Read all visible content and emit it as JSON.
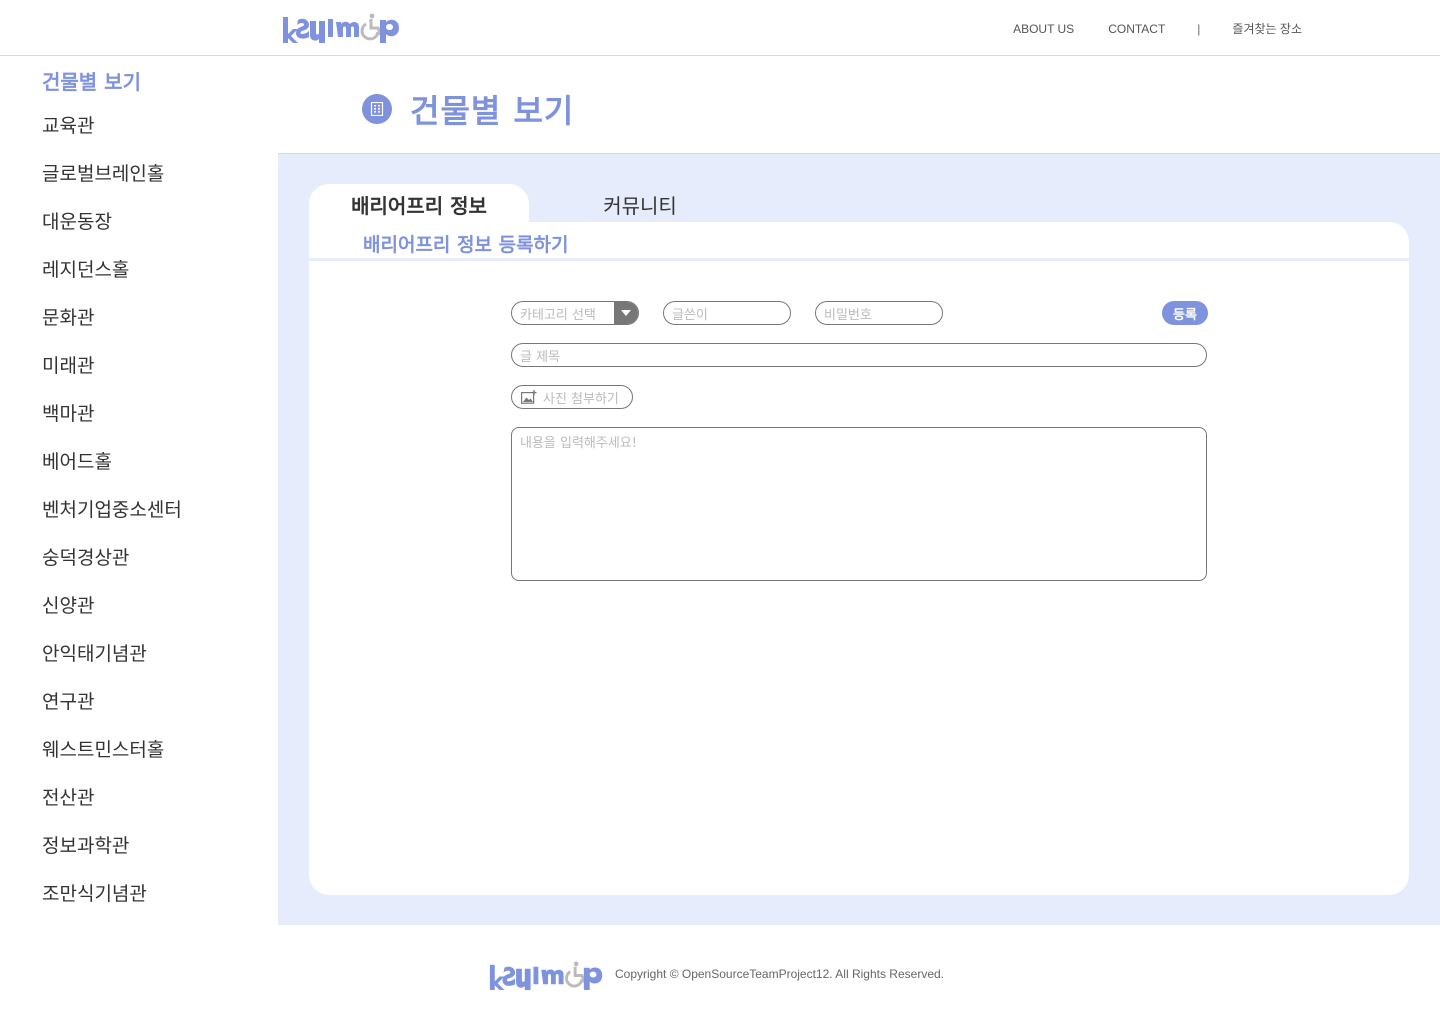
{
  "header": {
    "nav": {
      "about": "ABOUT US",
      "contact": "CONTACT",
      "separator": "|",
      "favorites": "즐겨찾는 장소"
    }
  },
  "sidebar": {
    "title": "건물별 보기",
    "items": [
      {
        "label": "교육관"
      },
      {
        "label": "글로벌브레인홀"
      },
      {
        "label": "대운동장"
      },
      {
        "label": "레지던스홀"
      },
      {
        "label": "문화관"
      },
      {
        "label": "미래관"
      },
      {
        "label": "백마관"
      },
      {
        "label": "베어드홀"
      },
      {
        "label": "벤처기업중소센터"
      },
      {
        "label": "숭덕경상관"
      },
      {
        "label": "신양관"
      },
      {
        "label": "안익태기념관"
      },
      {
        "label": "연구관"
      },
      {
        "label": "웨스트민스터홀"
      },
      {
        "label": "전산관"
      },
      {
        "label": "정보과학관"
      },
      {
        "label": "조만식기념관"
      }
    ]
  },
  "main": {
    "page_title": "건물별 보기",
    "page_icon": "building-icon",
    "tabs": [
      {
        "label": "배리어프리 정보",
        "active": true
      },
      {
        "label": "커뮤니티",
        "active": false
      }
    ],
    "form": {
      "heading": "배리어프리 정보 등록하기",
      "category_placeholder": "카테고리 선택",
      "writer_placeholder": "글쓴이",
      "password_placeholder": "비밀번호",
      "register_label": "등록",
      "title_placeholder": "글 제목",
      "attach_label": "사진 첨부하기",
      "content_placeholder": "내용을 입력해주세요!"
    }
  },
  "footer": {
    "copyright": "Copyright © OpenSourceTeamProject12. All Rights Reserved."
  },
  "colors": {
    "accent": "#7e92de",
    "panel": "#e6ecfb"
  }
}
